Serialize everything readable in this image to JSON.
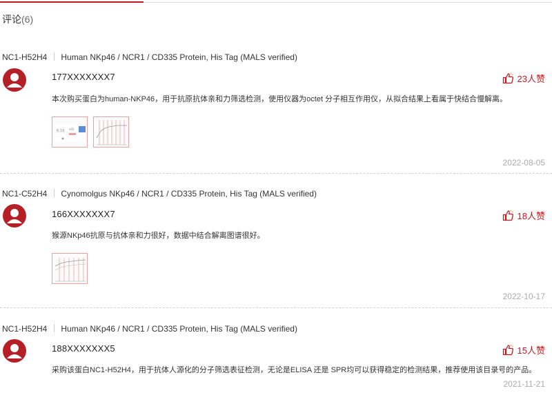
{
  "section": {
    "title": "评论",
    "count": "(6)"
  },
  "reviews": [
    {
      "sku": "NC1-H52H4",
      "product": "Human NKp46 / NCR1 / CD335 Protein, His Tag (MALS verified)",
      "user": "177XXXXXXX7",
      "likes": "23人赞",
      "comment": "本次购买蛋白为human-NKP46，用于抗原抗体亲和力筛选检测，使用仪器为octet 分子相互作用仪，从拟合结果上看属于快结合慢解离。",
      "date": "2022-08-05"
    },
    {
      "sku": "NC1-C52H4",
      "product": "Cynomolgus NKp46 / NCR1 / CD335 Protein, His Tag (MALS verified)",
      "user": "166XXXXXXX7",
      "likes": "18人赞",
      "comment": "猴源NKp46抗原与抗体亲和力很好，数据中结合解离图谱很好。",
      "date": "2022-10-17"
    },
    {
      "sku": "NC1-H52H4",
      "product": "Human NKp46 / NCR1 / CD335 Protein, His Tag (MALS verified)",
      "user": "188XXXXXXX5",
      "likes": "15人赞",
      "comment": "采购该蛋白NC1-H52H4，用于抗体人源化的分子筛选表征检测，无论是ELISA 还是 SPR均可以获得稳定的检测结果，推荐使用该目录号的产品。",
      "date": "2021-11-21"
    }
  ],
  "colors": {
    "accent": "#c8161d",
    "avatar": "#b42026",
    "muted": "#aaaaaa"
  },
  "icons": {
    "like": "thumbs-up-icon",
    "avatar": "user-avatar-icon"
  }
}
